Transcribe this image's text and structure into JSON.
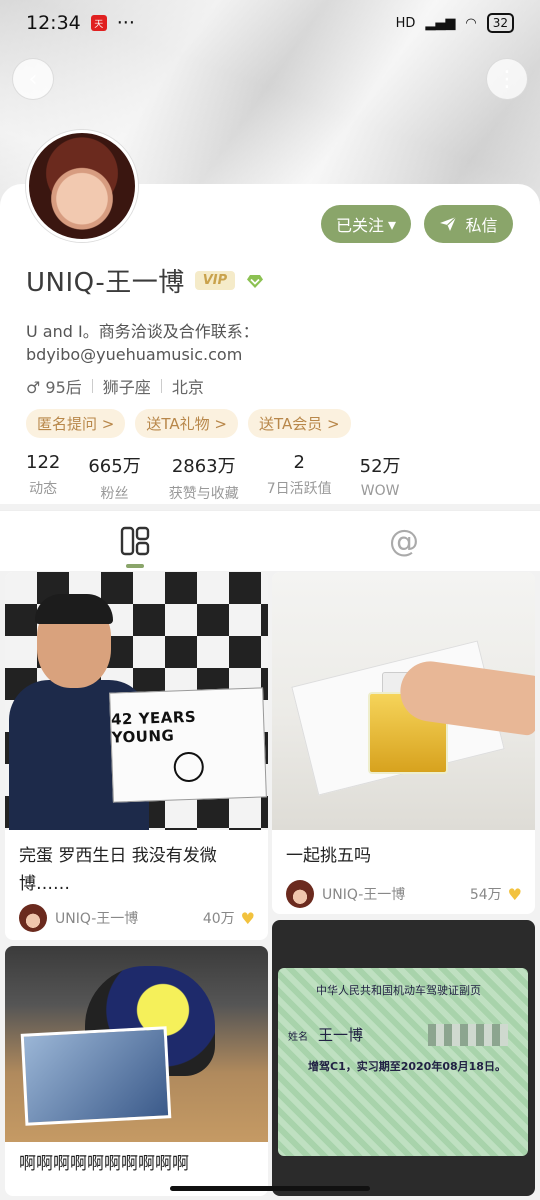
{
  "status_bar": {
    "time": "12:34",
    "app_badge": "天",
    "dots": "···",
    "network": "HD",
    "battery": "32"
  },
  "header": {
    "back_icon": "‹",
    "more_icon": "⋮"
  },
  "profile": {
    "name": "UNIQ-王一博",
    "vip_label": "VIP",
    "follow_button": "已关注",
    "message_button": "私信",
    "bio_line1": "U and I。商务洽谈及合作联系：",
    "bio_line2": "bdyibo@yuehuamusic.com",
    "gender_age": "♂ 95后",
    "zodiac": "狮子座",
    "location": "北京",
    "tags": [
      "匿名提问 >",
      "送TA礼物 >",
      "送TA会员 >"
    ],
    "stats": [
      {
        "value": "122",
        "label": "动态"
      },
      {
        "value": "665万",
        "label": "粉丝"
      },
      {
        "value": "2863万",
        "label": "获赞与收藏"
      },
      {
        "value": "2",
        "label": "7日活跃值"
      },
      {
        "value": "52万",
        "label": "WOW"
      }
    ]
  },
  "tabs": {
    "posts_icon": "posts-grid-icon",
    "mentions_icon": "@"
  },
  "feed": [
    {
      "image_text": "42 YEARS YOUNG",
      "title": "完蛋 罗西生日 我没有发微博……",
      "author": "UNIQ-王一博",
      "likes": "40万"
    },
    {
      "title": "一起挑五吗",
      "author": "UNIQ-王一博",
      "likes": "54万"
    },
    {
      "title": "啊啊啊啊啊啊啊啊啊啊"
    },
    {
      "license_title": "中华人民共和国机动车驾驶证副页",
      "license_name_label": "姓名",
      "license_name": "王一博",
      "license_note": "增驾C1，实习期至2020年08月18日。"
    }
  ],
  "colors": {
    "accent": "#8aa56a",
    "tag_bg": "#fbf1df",
    "tag_text": "#b8874a",
    "like": "#f2c23e"
  }
}
